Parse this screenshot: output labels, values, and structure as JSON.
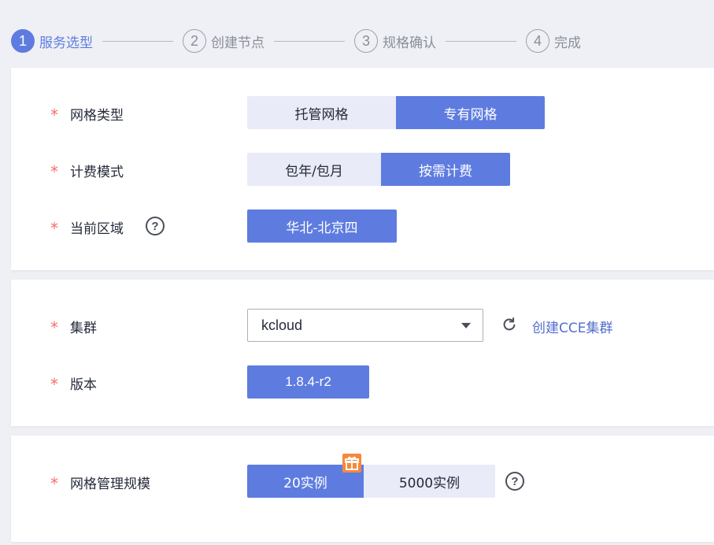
{
  "steps": [
    {
      "num": "1",
      "label": "服务选型",
      "active": true
    },
    {
      "num": "2",
      "label": "创建节点",
      "active": false
    },
    {
      "num": "3",
      "label": "规格确认",
      "active": false
    },
    {
      "num": "4",
      "label": "完成",
      "active": false
    }
  ],
  "required_mark": "*",
  "mesh_type": {
    "label": "网格类型",
    "options": [
      "托管网格",
      "专有网格"
    ],
    "selected": "专有网格"
  },
  "billing_mode": {
    "label": "计费模式",
    "options": [
      "包年/包月",
      "按需计费"
    ],
    "selected": "按需计费"
  },
  "region": {
    "label": "当前区域",
    "help_icon": "question-circle-icon",
    "value": "华北-北京四"
  },
  "cluster": {
    "label": "集群",
    "value": "kcloud",
    "refresh_icon": "refresh-icon",
    "create_link": "创建CCE集群"
  },
  "version": {
    "label": "版本",
    "value": "1.8.4-r2"
  },
  "mesh_scale": {
    "label": "网格管理规模",
    "options": [
      "20实例",
      "5000实例"
    ],
    "selected": "20实例",
    "gift_icon": "gift-icon",
    "help_icon": "question-circle-icon"
  },
  "colors": {
    "primary": "#5e7ce0",
    "segment_bg": "#e9ebf8",
    "required": "#f66f6a",
    "link": "#526ecc",
    "gift": "#f5883e"
  }
}
